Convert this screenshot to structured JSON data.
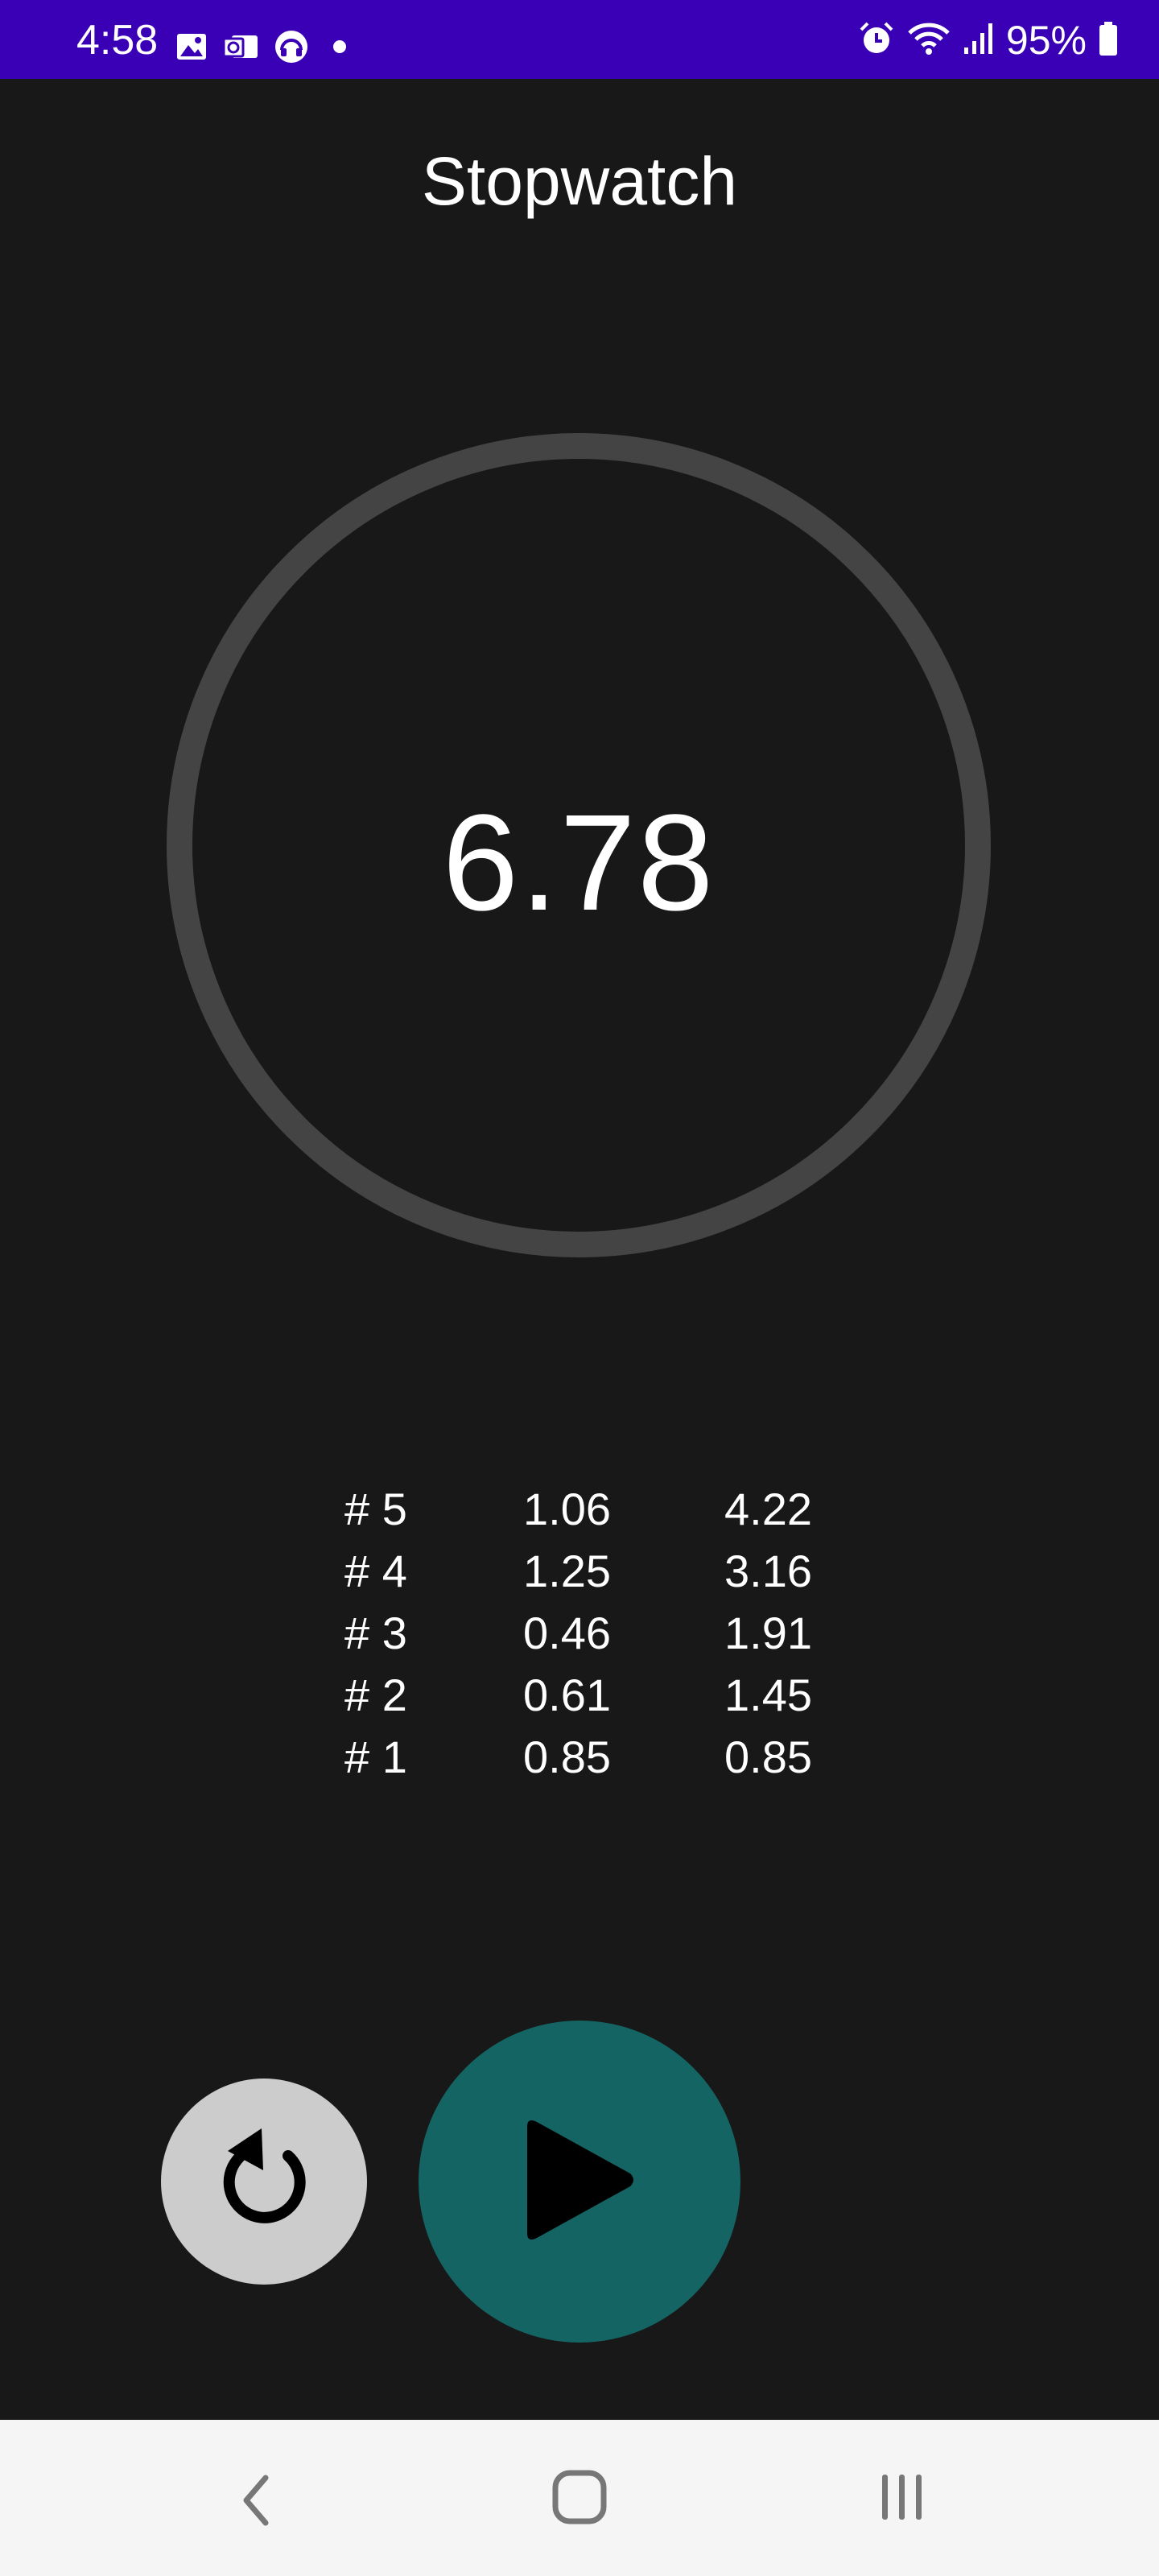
{
  "status_bar": {
    "time": "4:58",
    "battery": "95%",
    "notification_icons": [
      "gallery-icon",
      "outlook-icon",
      "headset-icon",
      "dot-icon"
    ],
    "system_icons": [
      "alarm-icon",
      "wifi-icon",
      "signal-icon",
      "battery-icon"
    ],
    "color": "#3a00b6"
  },
  "app": {
    "title": "Stopwatch",
    "elapsed": "6.78"
  },
  "laps": [
    {
      "num": "# 5",
      "lap": "1.06",
      "total": "4.22"
    },
    {
      "num": "# 4",
      "lap": "1.25",
      "total": "3.16"
    },
    {
      "num": "# 3",
      "lap": "0.46",
      "total": "1.91"
    },
    {
      "num": "# 2",
      "lap": "0.61",
      "total": "1.45"
    },
    {
      "num": "# 1",
      "lap": "0.85",
      "total": "0.85"
    }
  ],
  "controls": {
    "reset_icon": "reset-icon",
    "play_icon": "play-icon",
    "play_color": "#146464",
    "reset_color": "#cccccc"
  },
  "nav_bar": {
    "icons": [
      "back-icon",
      "home-icon",
      "recents-icon"
    ]
  }
}
